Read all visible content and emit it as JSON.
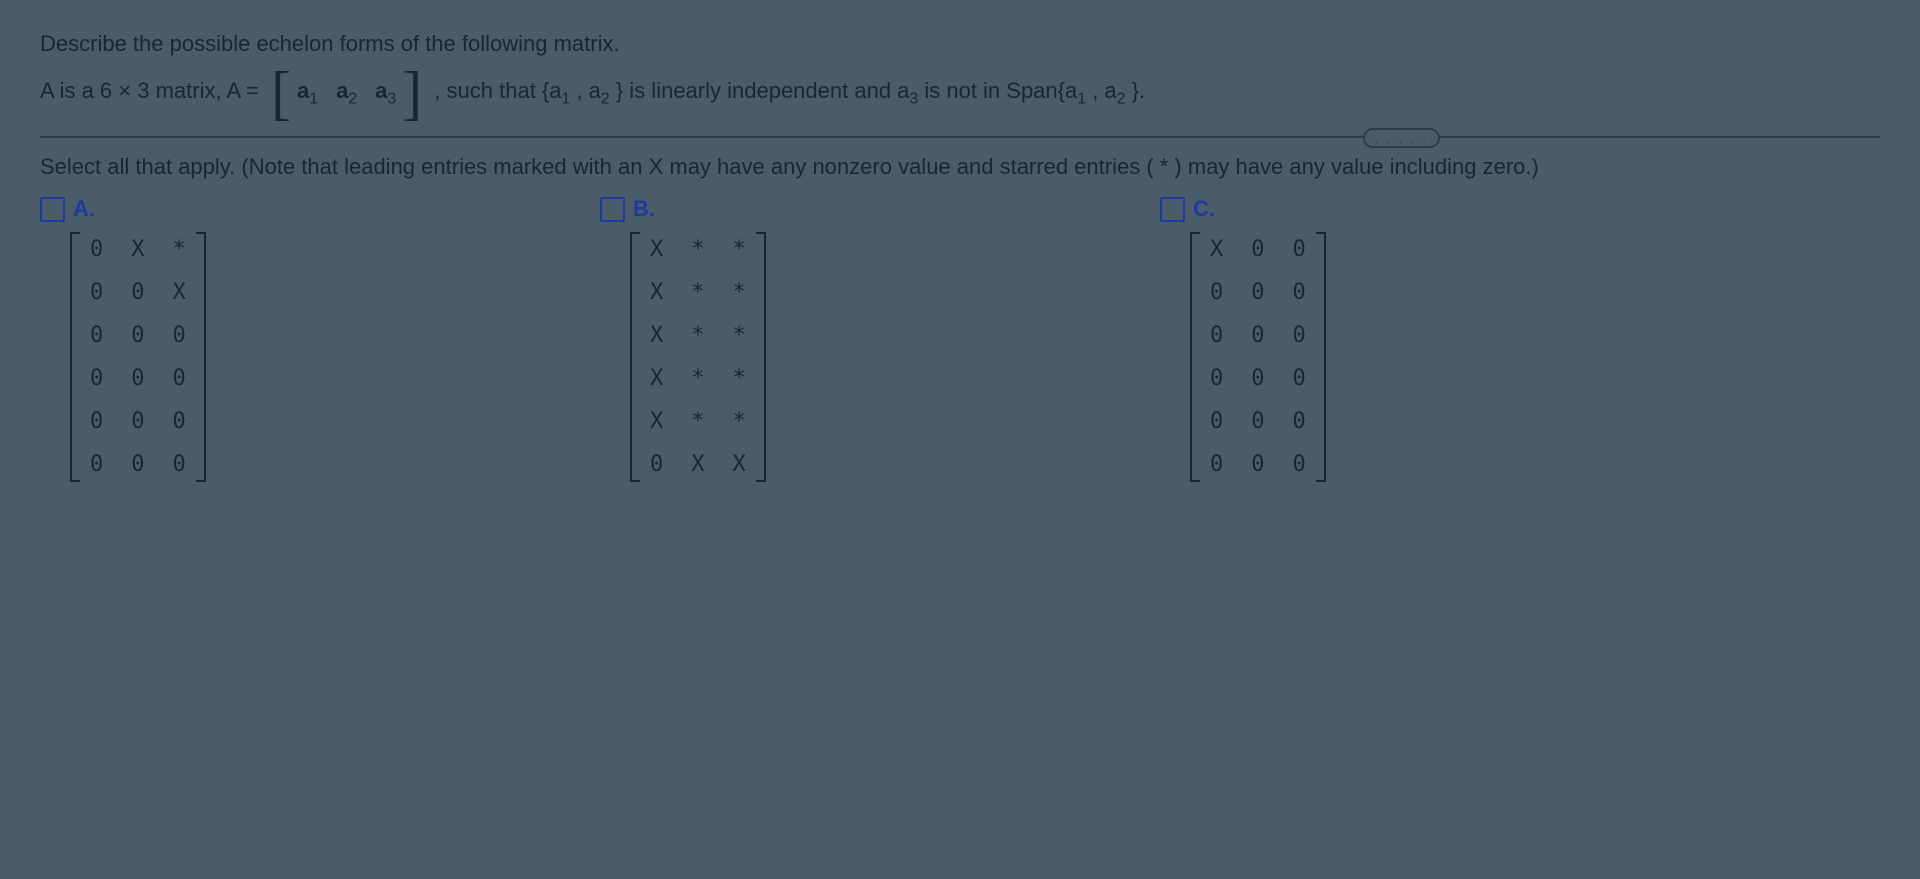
{
  "question": {
    "line1": "Describe the possible echelon forms of the following matrix.",
    "line2_pre": "A is a 6 × 3 matrix, A = ",
    "line2_cols": [
      "a",
      "a",
      "a"
    ],
    "line2_subs": [
      "1",
      "2",
      "3"
    ],
    "line2_post_a": ", such that {a",
    "line2_post_b": ", a",
    "line2_post_c": "} is linearly independent and a",
    "line2_post_d": " is not in Span{a",
    "line2_post_e": ", a",
    "line2_post_f": "}."
  },
  "bubble": ". . . . .",
  "instruction": "Select all that apply. (Note that leading entries marked with an X may have any nonzero value and starred entries ( * ) may have any value including zero.)",
  "options": {
    "A": {
      "label": "A.",
      "rows": [
        [
          "0",
          "X",
          "*"
        ],
        [
          "0",
          "0",
          "X"
        ],
        [
          "0",
          "0",
          "0"
        ],
        [
          "0",
          "0",
          "0"
        ],
        [
          "0",
          "0",
          "0"
        ],
        [
          "0",
          "0",
          "0"
        ]
      ]
    },
    "B": {
      "label": "B.",
      "rows": [
        [
          "X",
          "*",
          "*"
        ],
        [
          "X",
          "*",
          "*"
        ],
        [
          "X",
          "*",
          "*"
        ],
        [
          "X",
          "*",
          "*"
        ],
        [
          "X",
          "*",
          "*"
        ],
        [
          "0",
          "X",
          "X"
        ]
      ]
    },
    "C": {
      "label": "C.",
      "rows": [
        [
          "X",
          "0",
          "0"
        ],
        [
          "0",
          "0",
          "0"
        ],
        [
          "0",
          "0",
          "0"
        ],
        [
          "0",
          "0",
          "0"
        ],
        [
          "0",
          "0",
          "0"
        ],
        [
          "0",
          "0",
          "0"
        ]
      ]
    }
  }
}
